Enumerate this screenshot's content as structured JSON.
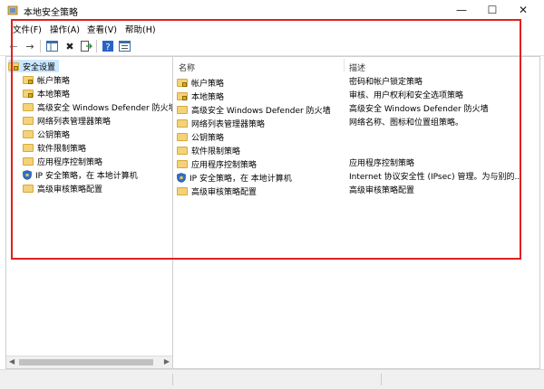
{
  "window": {
    "title": "本地安全策略"
  },
  "controls": {
    "minimize": "—",
    "maximize": "☐",
    "close": "✕"
  },
  "menu": [
    "文件(F)",
    "操作(A)",
    "查看(V)",
    "帮助(H)"
  ],
  "tree": {
    "root": "安全设置",
    "items": [
      "帐户策略",
      "本地策略",
      "高级安全 Windows Defender 防火墙",
      "网络列表管理器策略",
      "公钥策略",
      "软件限制策略",
      "应用程序控制策略",
      "IP 安全策略，在 本地计算机",
      "高级审核策略配置"
    ]
  },
  "list": {
    "columns": [
      "名称",
      "描述"
    ],
    "rows": [
      {
        "name": "帐户策略",
        "desc": "密码和帐户锁定策略"
      },
      {
        "name": "本地策略",
        "desc": "审核、用户权利和安全选项策略"
      },
      {
        "name": "高级安全 Windows Defender 防火墙",
        "desc": "高级安全 Windows Defender 防火墙"
      },
      {
        "name": "网络列表管理器策略",
        "desc": "网络名称、图标和位置组策略。"
      },
      {
        "name": "公钥策略",
        "desc": ""
      },
      {
        "name": "软件限制策略",
        "desc": ""
      },
      {
        "name": "应用程序控制策略",
        "desc": "应用程序控制策略"
      },
      {
        "name": "IP 安全策略，在 本地计算机",
        "desc": "Internet 协议安全性 (IPsec) 管理。为与别的..."
      },
      {
        "name": "高级审核策略配置",
        "desc": "高级审核策略配置"
      }
    ]
  },
  "colors": {
    "highlight": "#e0201e",
    "selection": "#cce8ff"
  }
}
